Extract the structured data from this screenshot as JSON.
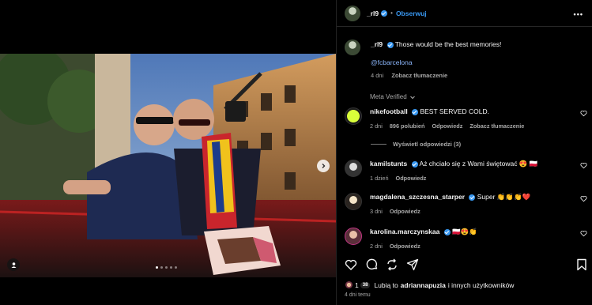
{
  "post": {
    "author": "_rl9",
    "follow_label": "Obserwuj",
    "more_icon": "more-horizontal-icon"
  },
  "caption": {
    "author": "_rl9",
    "text": "Those would be the best memories!",
    "mention": "@fcbarcelona",
    "age": "4 dni",
    "translate_label": "Zobacz tłumaczenie"
  },
  "meta_verified": {
    "label": "Meta Verified",
    "icon": "chevron-down-icon"
  },
  "comments": [
    {
      "user": "nikefootball",
      "text": "BEST SERVED COLD.",
      "age": "2 dni",
      "likes": "896 polubień",
      "reply_label": "Odpowiedz",
      "translate_label": "Zobacz tłumaczenie",
      "view_replies_label": "Wyświetl odpowiedzi (3)"
    },
    {
      "user": "kamilstunts",
      "text": "Aż chciało się z Wami świętować 😍",
      "flag": "🇵🇱",
      "age": "1 dzień",
      "reply_label": "Odpowiedz"
    },
    {
      "user": "magdalena_szczesna_starper",
      "text": "Super 👏👏👏❤️",
      "age": "3 dni",
      "reply_label": "Odpowiedz"
    },
    {
      "user": "karolina.marczynskaa",
      "text": "🇵🇱😍👏",
      "age": "2 dni",
      "reply_label": "Odpowiedz"
    }
  ],
  "likes": {
    "count_badge": "38",
    "prefix": "1",
    "text_before": "Lubią to",
    "user": "adriannapuzia",
    "text_after": "i innych użytkowników"
  },
  "posted": "4 dni temu",
  "carousel": {
    "current": 1,
    "total": 5
  },
  "colors": {
    "accent": "#3897f0",
    "background": "#000000",
    "muted": "#a8a8a8"
  }
}
